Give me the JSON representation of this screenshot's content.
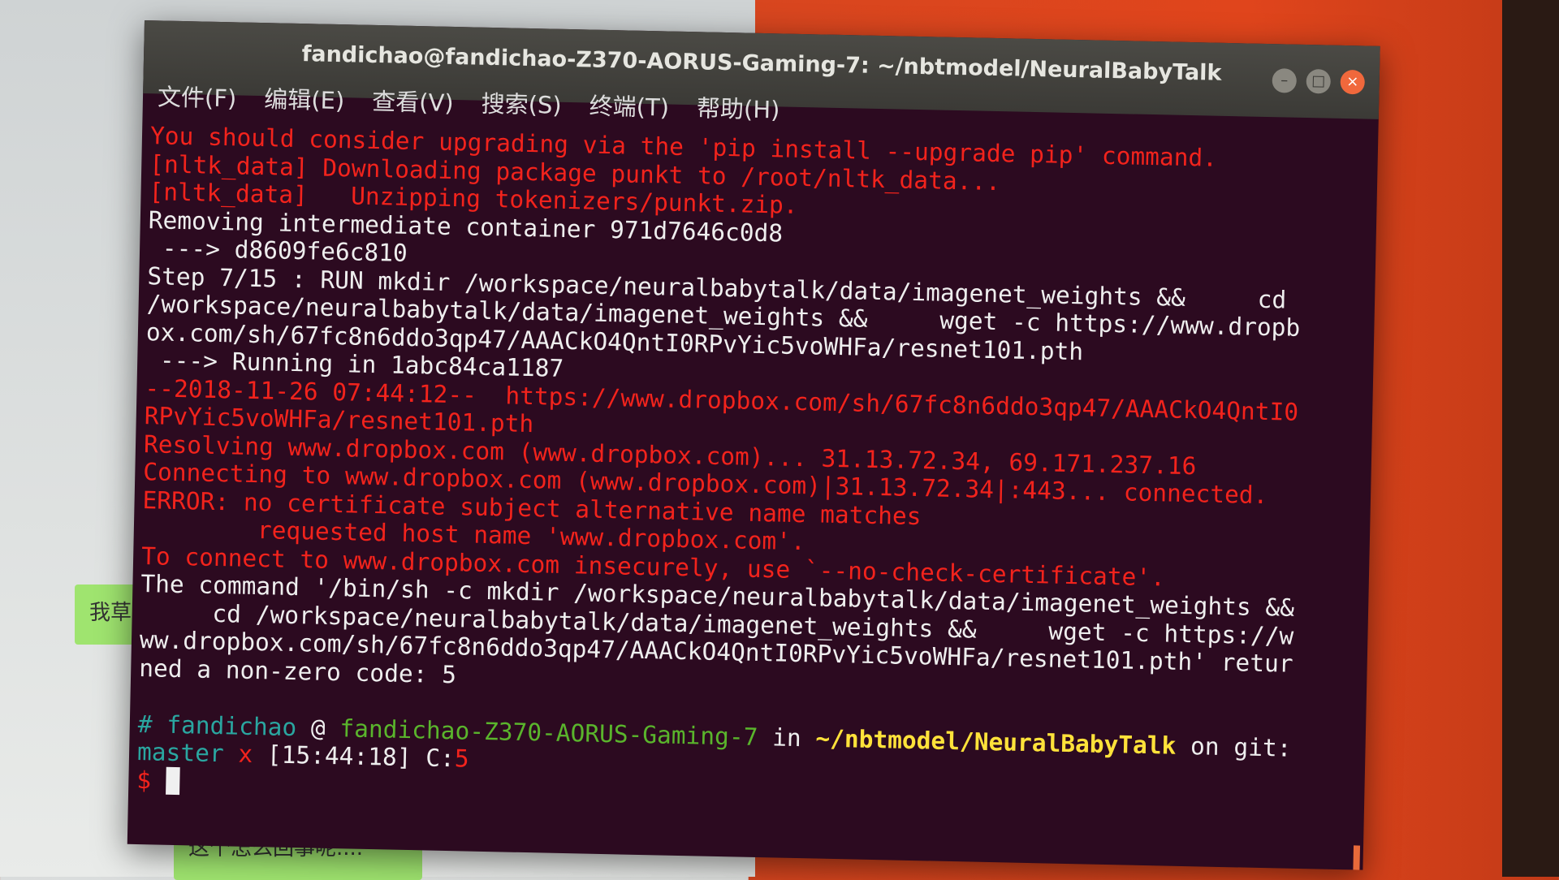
{
  "background_chat": {
    "bubble_1": "我草 ",
    "bubble_2": "这个怎么回事呢...."
  },
  "window": {
    "title": "fandichao@fandichao-Z370-AORUS-Gaming-7: ~/nbtmodel/NeuralBabyTalk",
    "buttons": {
      "minimize": "–",
      "maximize": "□",
      "close": "×"
    }
  },
  "menu": [
    "文件(F)",
    "编辑(E)",
    "查看(V)",
    "搜索(S)",
    "终端(T)",
    "帮助(H)"
  ],
  "colors": {
    "background": "#2c0a20",
    "error": "#f2231c",
    "prompt_user": "#2aa6a0",
    "prompt_host": "#5ab52c",
    "prompt_path": "#ffe23a"
  },
  "terminal_lines": [
    [
      {
        "t": "You should consider upgrading via the 'pip install --upgrade pip' command.",
        "c": "red"
      }
    ],
    [
      {
        "t": "[nltk_data] Downloading package punkt to /root/nltk_data...",
        "c": "red"
      }
    ],
    [
      {
        "t": "[nltk_data]   Unzipping tokenizers/punkt.zip.",
        "c": "red"
      }
    ],
    [
      {
        "t": "Removing intermediate container 971d7646c0d8",
        "c": "white"
      }
    ],
    [
      {
        "t": " ---> d8609fe6c810",
        "c": "white"
      }
    ],
    [
      {
        "t": "Step 7/15 : RUN mkdir /workspace/neuralbabytalk/data/imagenet_weights &&     cd",
        "c": "white"
      }
    ],
    [
      {
        "t": "/workspace/neuralbabytalk/data/imagenet_weights &&     wget -c https://www.dropb",
        "c": "white"
      }
    ],
    [
      {
        "t": "ox.com/sh/67fc8n6ddo3qp47/AAACkO4QntI0RPvYic5voWHFa/resnet101.pth",
        "c": "white"
      }
    ],
    [
      {
        "t": " ---> Running in 1abc84ca1187",
        "c": "white"
      }
    ],
    [
      {
        "t": "--2018-11-26 07:44:12--  https://www.dropbox.com/sh/67fc8n6ddo3qp47/AAACkO4QntI0",
        "c": "red"
      }
    ],
    [
      {
        "t": "RPvYic5voWHFa/resnet101.pth",
        "c": "red"
      }
    ],
    [
      {
        "t": "Resolving www.dropbox.com (www.dropbox.com)... 31.13.72.34, 69.171.237.16",
        "c": "red"
      }
    ],
    [
      {
        "t": "Connecting to www.dropbox.com (www.dropbox.com)|31.13.72.34|:443... connected.",
        "c": "red"
      }
    ],
    [
      {
        "t": "ERROR: no certificate subject alternative name matches",
        "c": "red"
      }
    ],
    [
      {
        "t": "        requested host name 'www.dropbox.com'.",
        "c": "red"
      }
    ],
    [
      {
        "t": "To connect to www.dropbox.com insecurely, use `--no-check-certificate'.",
        "c": "red"
      }
    ],
    [
      {
        "t": "The command '/bin/sh -c mkdir /workspace/neuralbabytalk/data/imagenet_weights &&",
        "c": "white"
      }
    ],
    [
      {
        "t": "     cd /workspace/neuralbabytalk/data/imagenet_weights &&     wget -c https://w",
        "c": "white"
      }
    ],
    [
      {
        "t": "ww.dropbox.com/sh/67fc8n6ddo3qp47/AAACkO4QntI0RPvYic5voWHFa/resnet101.pth' retur",
        "c": "white"
      }
    ],
    [
      {
        "t": "ned a non-zero code: 5",
        "c": "white"
      }
    ],
    [
      {
        "t": "",
        "c": "white"
      }
    ],
    [
      {
        "t": "# ",
        "c": "teal"
      },
      {
        "t": "fandichao",
        "c": "teal"
      },
      {
        "t": " @ ",
        "c": "white"
      },
      {
        "t": "fandichao-Z370-AORUS-Gaming-7",
        "c": "green"
      },
      {
        "t": " in ",
        "c": "white"
      },
      {
        "t": "~/nbtmodel/NeuralBabyTalk",
        "c": "yellow"
      },
      {
        "t": " on git:",
        "c": "white"
      }
    ],
    [
      {
        "t": "master",
        "c": "teal"
      },
      {
        "t": " x ",
        "c": "red"
      },
      {
        "t": "[15:44:18] C:",
        "c": "white"
      },
      {
        "t": "5",
        "c": "red"
      }
    ],
    [
      {
        "t": "$ ",
        "c": "red"
      },
      {
        "t": " ",
        "c": "cursor"
      }
    ]
  ]
}
